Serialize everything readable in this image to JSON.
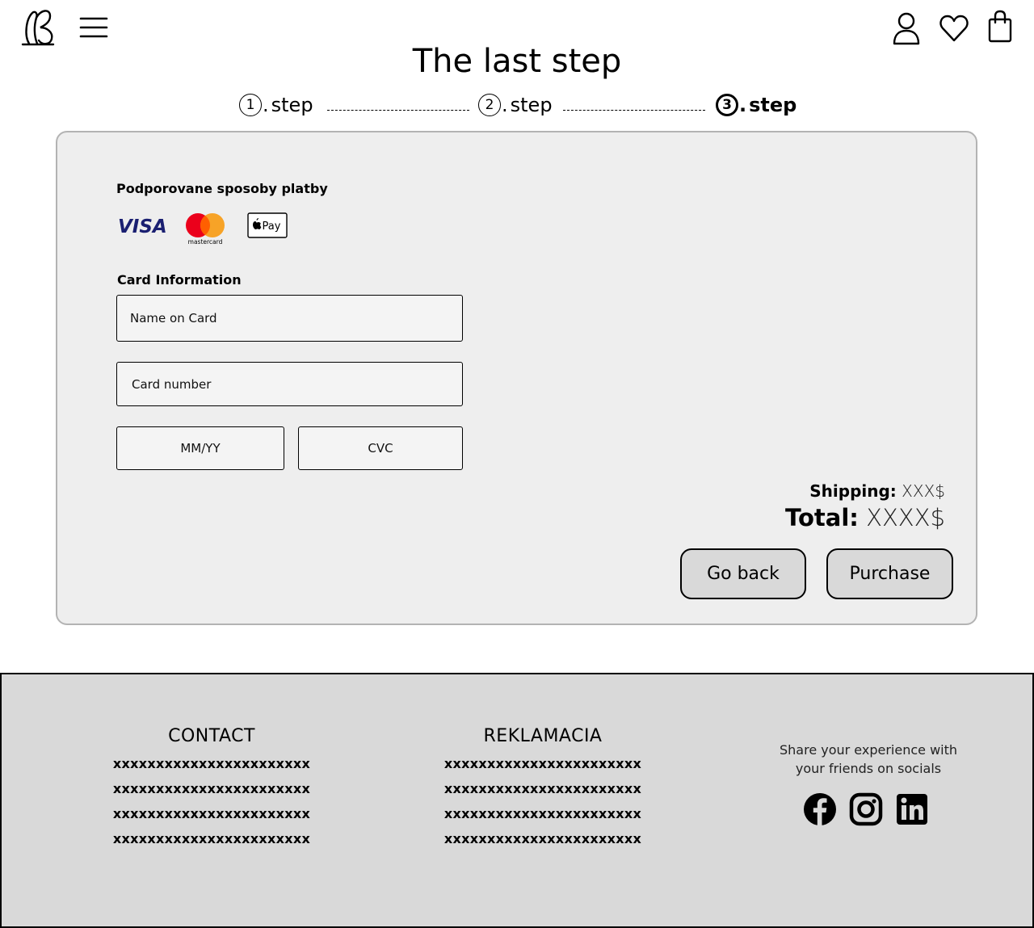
{
  "header": {
    "title": "The last step"
  },
  "steps": [
    {
      "number": "1",
      "dot": ".",
      "label": "step",
      "active": false
    },
    {
      "number": "2",
      "dot": ".",
      "label": "step",
      "active": false
    },
    {
      "number": "3",
      "dot": ".",
      "label": "step",
      "active": true
    }
  ],
  "payment": {
    "methods_label": "Podporovane sposoby platby",
    "methods": [
      {
        "name": "VISA"
      },
      {
        "name": "mastercard"
      },
      {
        "name": "Pay"
      }
    ],
    "card_info_label": "Card Information",
    "name_placeholder": "Name on Card",
    "number_placeholder": "Card number",
    "expiry_placeholder": "MM/YY",
    "cvc_placeholder": "CVC"
  },
  "summary": {
    "shipping_label": "Shipping:",
    "shipping_value": "XXX$",
    "total_label": "Total:",
    "total_value": "XXXX$"
  },
  "actions": {
    "back_label": "Go back",
    "purchase_label": "Purchase"
  },
  "footer": {
    "contact": {
      "title": "CONTACT",
      "lines": [
        "xxxxxxxxxxxxxxxxxxxxxxx",
        "xxxxxxxxxxxxxxxxxxxxxxx",
        "xxxxxxxxxxxxxxxxxxxxxxx",
        "xxxxxxxxxxxxxxxxxxxxxxx"
      ]
    },
    "complaints": {
      "title": "REKLAMACIA",
      "lines": [
        "xxxxxxxxxxxxxxxxxxxxxxx",
        "xxxxxxxxxxxxxxxxxxxxxxx",
        "xxxxxxxxxxxxxxxxxxxxxxx",
        "xxxxxxxxxxxxxxxxxxxxxxx"
      ]
    },
    "share_text": "Share your experience with your friends on socials",
    "socials": [
      "facebook-icon",
      "instagram-icon",
      "linkedin-icon"
    ]
  },
  "colors": {
    "card_bg": "#eeeeee",
    "card_border": "#b3b3b3",
    "button_bg": "#d9d9d9",
    "footer_bg": "#d9d9d9",
    "visa_blue": "#1a1f71",
    "mc_red": "#eb001b",
    "mc_orange": "#f79e1b"
  }
}
